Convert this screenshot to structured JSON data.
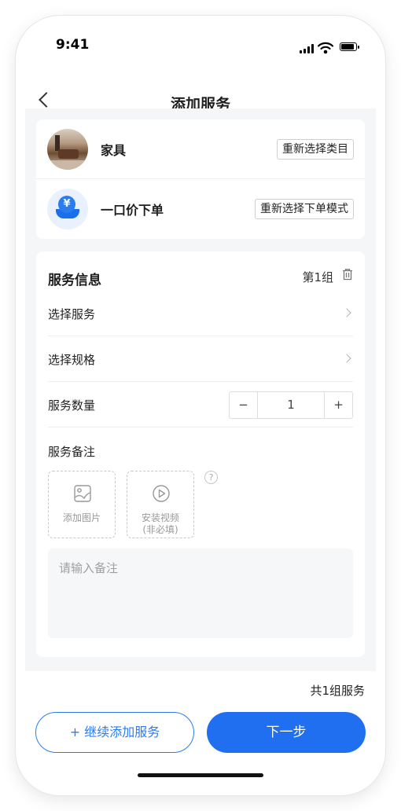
{
  "status_bar": {
    "time": "9:41"
  },
  "navbar": {
    "title": "添加服务",
    "back_icon": "chevron-left-icon"
  },
  "selection": {
    "category": {
      "name": "家具",
      "button": "重新选择类目",
      "icon": "furniture-photo"
    },
    "mode": {
      "name": "一口价下单",
      "button": "重新选择下单模式",
      "icon": "yuan-hand-icon"
    }
  },
  "service_info": {
    "title": "服务信息",
    "group_label": "第1组",
    "select_service": "选择服务",
    "select_spec": "选择规格",
    "quantity_label": "服务数量",
    "quantity": {
      "minus": "−",
      "value": "1",
      "plus": "+"
    },
    "remark_title": "服务备注",
    "add_image": "添加图片",
    "install_video": [
      "安装视频",
      "(非必填)"
    ],
    "remark_placeholder": "请输入备注",
    "help_icon": "question-circle-icon"
  },
  "footer": {
    "total": "共1组服务",
    "add_more": "+ 继续添加服务",
    "next": "下一步"
  },
  "colors": {
    "primary": "#1f6ff0",
    "background": "#f5f6f8"
  }
}
